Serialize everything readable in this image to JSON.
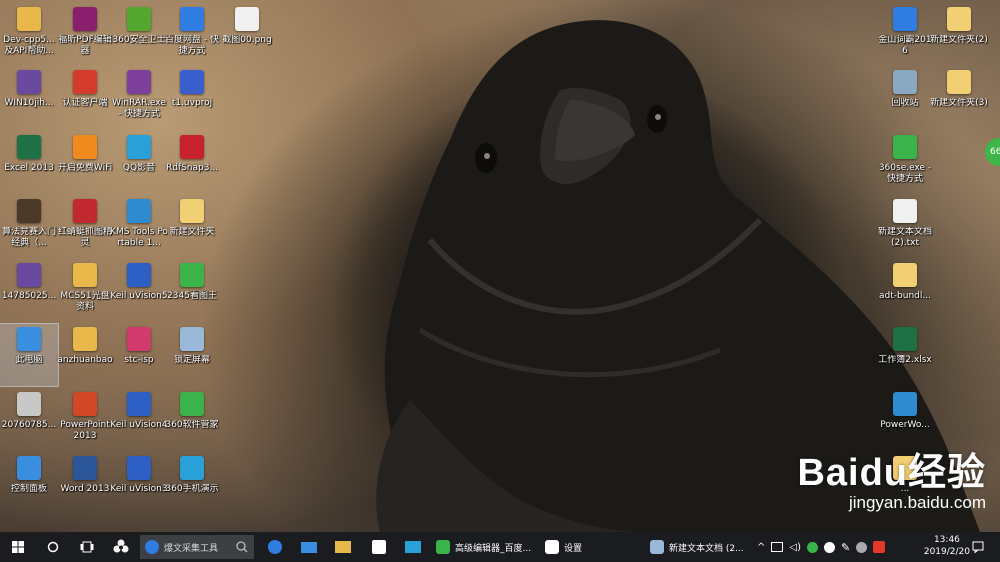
{
  "left_icons": [
    {
      "label": "Dev-cpp5... 及API帮助...",
      "icon": "folder-icon",
      "color": "#e8b84a"
    },
    {
      "label": "福昕PDF编辑器",
      "icon": "foxit-pdf-icon",
      "color": "#8a1f6e"
    },
    {
      "label": "360安全卫士",
      "icon": "360-shield-icon",
      "color": "#55a630"
    },
    {
      "label": "百度网盘 - 快捷方式",
      "icon": "baidu-netdisk-icon",
      "color": "#2f7de1"
    },
    {
      "label": "截图00.png",
      "icon": "image-file-icon",
      "color": "#f0f0f0"
    },
    {
      "label": "WIN10jih...",
      "icon": "winrar-archive-icon",
      "color": "#6a4aa0"
    },
    {
      "label": "认证客户端",
      "icon": "auth-client-icon",
      "color": "#d33c2c"
    },
    {
      "label": "WinRAR.exe - 快捷方式",
      "icon": "winrar-icon",
      "color": "#7c3f9b"
    },
    {
      "label": "t1.uvproj",
      "icon": "keil-project-icon",
      "color": "#3a5fcd"
    },
    {
      "label": "Excel 2013",
      "icon": "excel-icon",
      "color": "#1e7145"
    },
    {
      "label": "开启免费WiFi",
      "icon": "wifi-icon",
      "color": "#f08a1c"
    },
    {
      "label": "QQ影音",
      "icon": "qq-player-icon",
      "color": "#2aa0d8"
    },
    {
      "label": "RdfSnap3...",
      "icon": "rdfsnap-icon",
      "color": "#c8202c"
    },
    {
      "label": "算法竞赛入门经典（...",
      "icon": "book-icon",
      "color": "#4b3a2a"
    },
    {
      "label": "红蜻蜓抓图精灵",
      "icon": "dragonfly-icon",
      "color": "#c0292f"
    },
    {
      "label": "KMS Tools Portable 1...",
      "icon": "kms-tools-icon",
      "color": "#2e8bd0"
    },
    {
      "label": "新建文件夹",
      "icon": "folder-icon",
      "color": "#f1cf72"
    },
    {
      "label": "14785025...",
      "icon": "winrar-archive-icon",
      "color": "#6a4aa0"
    },
    {
      "label": "MCS51光盘资料",
      "icon": "folder-icon",
      "color": "#e8b84a"
    },
    {
      "label": "Keil uVision5",
      "icon": "keil-icon",
      "color": "#2d5fc4"
    },
    {
      "label": "2345看图王",
      "icon": "2345-viewer-icon",
      "color": "#3ab44a"
    },
    {
      "label": "此电脑",
      "icon": "computer-icon",
      "color": "#3a8ee0"
    },
    {
      "label": "anzhuanbao",
      "icon": "folder-icon",
      "color": "#e8b84a"
    },
    {
      "label": "stc-isp",
      "icon": "stc-isp-icon",
      "color": "#d03a6c"
    },
    {
      "label": "锁定屏幕",
      "icon": "lock-screen-file-icon",
      "color": "#9ab8d8"
    },
    {
      "label": "20760785...",
      "icon": "file-icon",
      "color": "#c8c8c8"
    },
    {
      "label": "PowerPoint 2013",
      "icon": "powerpoint-icon",
      "color": "#d24726"
    },
    {
      "label": "Keil uVision4",
      "icon": "keil-icon",
      "color": "#2d5fc4"
    },
    {
      "label": "360软件管家",
      "icon": "360-software-icon",
      "color": "#3ab44a"
    },
    {
      "label": "控制面板",
      "icon": "control-panel-icon",
      "color": "#3a8ee0"
    },
    {
      "label": "Word 2013",
      "icon": "word-icon",
      "color": "#2b579a"
    },
    {
      "label": "Keil uVision3",
      "icon": "keil-icon",
      "color": "#2d5fc4"
    },
    {
      "label": "360手机演示",
      "icon": "360-phone-icon",
      "color": "#2aa0d8"
    }
  ],
  "right_icons": [
    {
      "label": "金山词霸2016",
      "icon": "jinshan-ciba-icon",
      "color": "#2f7de1"
    },
    {
      "label": "新建文件夹(2)",
      "icon": "folder-icon",
      "color": "#f1cf72"
    },
    {
      "label": "回收站",
      "icon": "recycle-bin-icon",
      "color": "#8aa8c0"
    },
    {
      "label": "新建文件夹(3)",
      "icon": "folder-icon",
      "color": "#f1cf72"
    },
    {
      "label": "360se.exe - 快捷方式",
      "icon": "360-browser-icon",
      "color": "#3ab44a"
    },
    {
      "label": "新建文本文档 (2).txt",
      "icon": "text-file-icon",
      "color": "#f0f0f0"
    },
    {
      "label": "adt-bundl...",
      "icon": "folder-icon",
      "color": "#f1cf72"
    },
    {
      "label": "工作簿2.xlsx",
      "icon": "excel-file-icon",
      "color": "#1e7145"
    },
    {
      "label": "PowerWo...",
      "icon": "cube-app-icon",
      "color": "#2e8bd0"
    },
    {
      "label": "...",
      "icon": "folder-icon",
      "color": "#f1cf72"
    }
  ],
  "taskbar": {
    "search_placeholder": "爆文采集工具",
    "tasks": [
      {
        "label": "高级编辑器_百度...",
        "color": "#3ab44a"
      },
      {
        "label": "设置",
        "color": "#ffffff"
      },
      {
        "label": "新建文本文档 (2...",
        "color": "#9ab8d8"
      }
    ],
    "time": "13:46",
    "date": "2019/2/20"
  },
  "edge_badge": "66",
  "watermark": {
    "big": "Baidu经验",
    "small": "jingyan.baidu.com"
  }
}
